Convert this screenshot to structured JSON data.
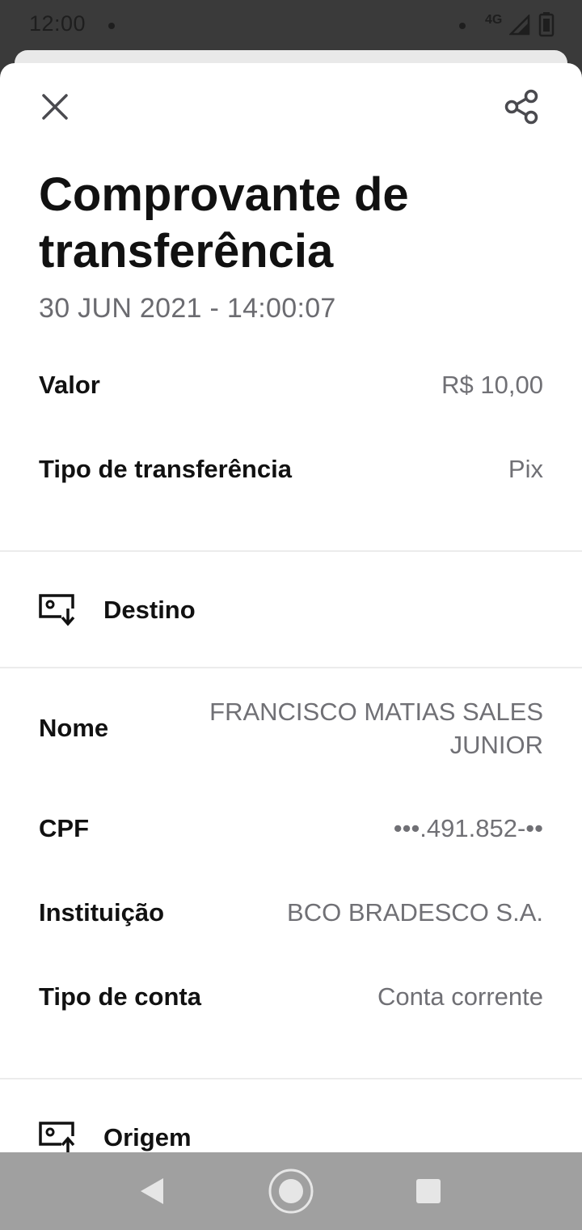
{
  "status_bar": {
    "time": "12:00",
    "network": "4G"
  },
  "header": {
    "title_line1": "Comprovante de",
    "title_line2": "transferência",
    "datetime": "30 JUN 2021 - 14:00:07"
  },
  "summary": [
    {
      "label": "Valor",
      "value": "R$ 10,00"
    },
    {
      "label": "Tipo de transferência",
      "value": "Pix"
    }
  ],
  "destino": {
    "section_label": "Destino",
    "nome_label": "Nome",
    "nome_line1": "FRANCISCO MATIAS SALES",
    "nome_line2": "JUNIOR",
    "cpf_label": "CPF",
    "cpf_value": "•••.491.852-••",
    "instituicao_label": "Instituição",
    "instituicao_value": "BCO BRADESCO S.A.",
    "tipo_conta_label": "Tipo de conta",
    "tipo_conta_value": "Conta corrente"
  },
  "origem": {
    "section_label": "Origem"
  },
  "icons": {
    "close": "close-icon",
    "share": "share-icon",
    "destino": "receive-money-icon",
    "origem": "send-money-icon",
    "nav_back": "back-triangle-icon",
    "nav_home": "home-circle-icon",
    "nav_recents": "recents-square-icon"
  },
  "colors": {
    "text_primary": "#111111",
    "text_secondary": "#707075",
    "nav_bar": "#a0a0a0"
  }
}
